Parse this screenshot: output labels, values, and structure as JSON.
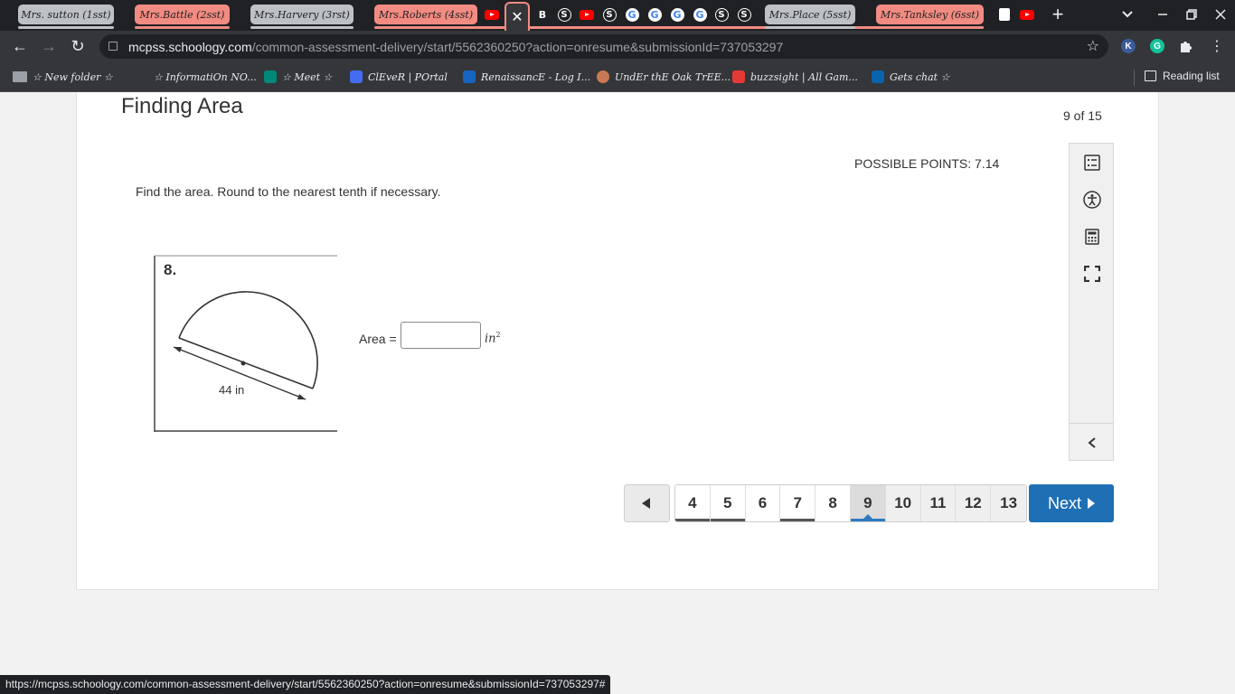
{
  "browser": {
    "tab_groups": [
      {
        "label": "Mrs. sutton (1sst)",
        "color": "grey"
      },
      {
        "label": "Mrs.Battle (2sst)",
        "color": "pink"
      },
      {
        "label": "Mrs.Harvery (3rst)",
        "color": "grey"
      },
      {
        "label": "Mrs.Roberts (4sst)",
        "color": "pink"
      },
      {
        "label": "Mrs.Place (5sst)",
        "color": "grey"
      },
      {
        "label": "Mrs.Tanksley (6sst)",
        "color": "pink"
      }
    ],
    "new_tab_label": "+",
    "url_host": "mcpss.schoology.com",
    "url_path": "/common-assessment-delivery/start/5562360250?action=onresume&submissionId=737053297",
    "extensions": [
      {
        "label": "K",
        "color": "#3c5a99"
      },
      {
        "label": "G",
        "color": "#15c39a"
      }
    ],
    "bookmarks": [
      {
        "label": "☆ New folder ☆",
        "icon": "folder-icon",
        "color": "#9aa0a6"
      },
      {
        "label": "☆ InformatiOn NO...",
        "icon": "none",
        "color": "#35363a"
      },
      {
        "label": "☆ Meet ☆",
        "icon": "meet-icon",
        "color": "#00897b"
      },
      {
        "label": "ClEveR | POrtal",
        "icon": "clever-icon",
        "color": "#436cf2"
      },
      {
        "label": "RenaissancE - Log I...",
        "icon": "renaissance-icon",
        "color": "#1565c0"
      },
      {
        "label": "UndEr thE Oak TrEE...",
        "icon": "oak-icon",
        "color": "#c97a52"
      },
      {
        "label": "buzzsight | All Gam...",
        "icon": "buzz-icon",
        "color": "#e53935"
      },
      {
        "label": "Gets chat ☆",
        "icon": "outlook-icon",
        "color": "#0a64ad"
      }
    ],
    "reading_list": "Reading list"
  },
  "assessment": {
    "title": "Finding Area",
    "counter": "9 of 15",
    "possible_points": "POSSIBLE POINTS: 7.14",
    "prompt": "Find the area. Round to the nearest tenth if necessary.",
    "figure": {
      "problem_number": "8.",
      "dimension_label": "44 in"
    },
    "answer_label": "Area =",
    "answer_value": "",
    "unit": "in",
    "unit_exponent": "2"
  },
  "pagination": {
    "pages": [
      {
        "label": "4",
        "state": "answered"
      },
      {
        "label": "5",
        "state": "answered"
      },
      {
        "label": "6",
        "state": "plain"
      },
      {
        "label": "7",
        "state": "answered"
      },
      {
        "label": "8",
        "state": "plain"
      },
      {
        "label": "9",
        "state": "current"
      },
      {
        "label": "10",
        "state": "light"
      },
      {
        "label": "11",
        "state": "light"
      },
      {
        "label": "12",
        "state": "light"
      },
      {
        "label": "13",
        "state": "light"
      }
    ],
    "next_label": "Next"
  },
  "status_url": "https://mcpss.schoology.com/common-assessment-delivery/start/5562360250?action=onresume&submissionId=737053297#"
}
